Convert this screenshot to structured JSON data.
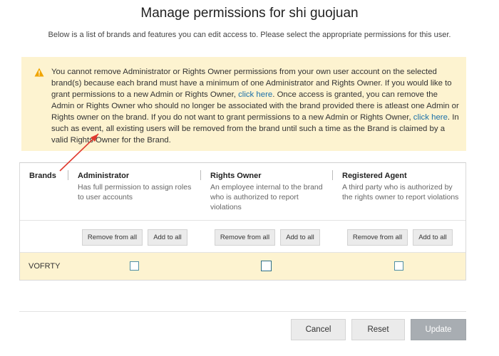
{
  "page": {
    "title": "Manage permissions for shi guojuan",
    "subtitle": "Below is a list of brands and features you can edit access to. Please select the appropriate permissions for this user."
  },
  "alert": {
    "text_1": "You cannot remove Administrator or Rights Owner permissions from your own user account on the selected brand(s) because each brand must have a minimum of one Administrator and Rights Owner. If you would like to grant permissions to a new Admin or Rights Owner, ",
    "link_1": "click here",
    "text_2": ". Once access is granted, you can remove the Admin or Rights Owner who should no longer be associated with the brand provided there is atleast one Admin or Rights owner on the brand. If you do not want to grant permissions to a new Admin or Rights Owner, ",
    "link_2": "click here",
    "text_3": ". In such as event, all existing users will be removed from the brand until such a time as the Brand is claimed by a valid Rights Owner for the Brand.",
    "icon": "warning-triangle-icon",
    "icon_color": "#f0a500"
  },
  "table": {
    "brands_header": "Brands",
    "columns": [
      {
        "name": "Administrator",
        "description": "Has full permission to assign roles to user accounts",
        "remove_all": "Remove from all",
        "add_all": "Add to all"
      },
      {
        "name": "Rights Owner",
        "description": "An employee internal to the brand who is authorized to report violations",
        "remove_all": "Remove from all",
        "add_all": "Add to all"
      },
      {
        "name": "Registered Agent",
        "description": "A third party who is authorized by the rights owner to report violations",
        "remove_all": "Remove from all",
        "add_all": "Add to all"
      }
    ],
    "rows": [
      {
        "brand": "VOFRTY",
        "administrator": false,
        "rights_owner": false,
        "registered_agent": false
      }
    ]
  },
  "footer": {
    "cancel": "Cancel",
    "reset": "Reset",
    "update": "Update"
  },
  "colors": {
    "alert_bg": "#fdf3d0",
    "link": "#1a6fa8",
    "annotation_arrow": "#e03a2f",
    "update_button_bg": "#a8adb2"
  }
}
